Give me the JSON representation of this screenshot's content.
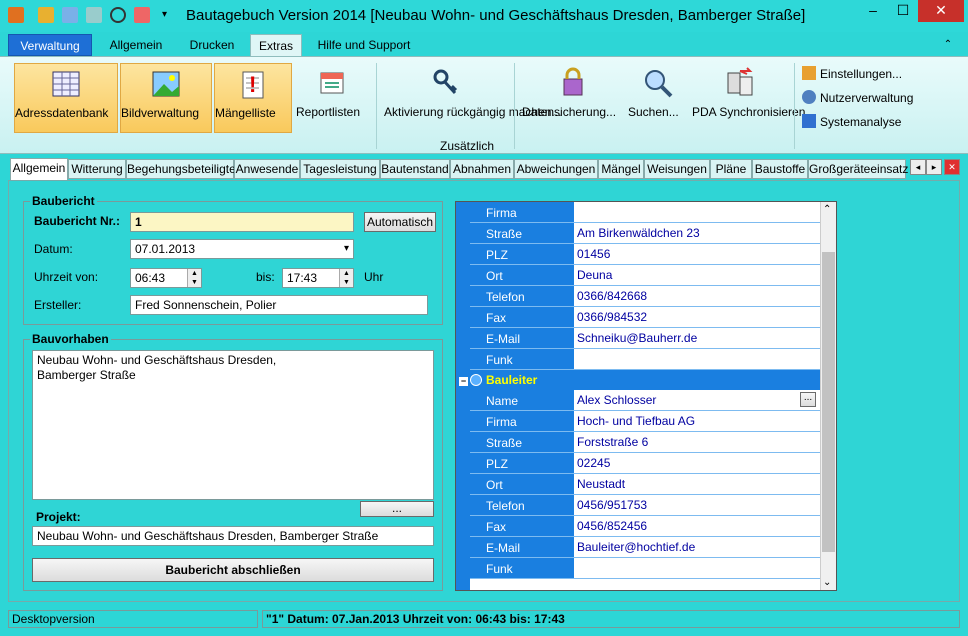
{
  "window": {
    "title": "Bautagebuch Version 2014 [Neubau Wohn- und Geschäftshaus Dresden, Bamberger Straße]",
    "controls": [
      "–",
      "☐",
      "✕"
    ]
  },
  "ribbon_tabs": [
    "Verwaltung",
    "Allgemein",
    "Drucken",
    "Extras",
    "Hilfe und Support"
  ],
  "ribbon": {
    "buttons": [
      {
        "label": "Adressdatenbank",
        "icon": "address-book-icon"
      },
      {
        "label": "Bildverwaltung",
        "icon": "image-icon"
      },
      {
        "label": "Mängelliste",
        "icon": "defect-list-icon"
      },
      {
        "label": "Reportlisten",
        "icon": "report-icon"
      },
      {
        "label": "Aktivierung rückgängig machen...",
        "icon": "keys-icon"
      },
      {
        "label": "Datensicherung...",
        "icon": "backup-icon"
      },
      {
        "label": "Suchen...",
        "icon": "search-icon"
      },
      {
        "label": "PDA Synchronisieren",
        "icon": "pda-sync-icon"
      }
    ],
    "small_buttons": [
      "Einstellungen...",
      "Nutzerverwaltung",
      "Systemanalyse"
    ],
    "group_label": "Zusätzlich"
  },
  "page_tabs": [
    "Allgemein",
    "Witterung",
    "Begehungsbeteiligte",
    "Anwesende",
    "Tagesleistung",
    "Bautenstand",
    "Abnahmen",
    "Abweichungen",
    "Mängel",
    "Weisungen",
    "Pläne",
    "Baustoffe",
    "Großgeräteeinsatz"
  ],
  "baubericht": {
    "title": "Baubericht",
    "nr_label": "Baubericht Nr.:",
    "nr_value": "1",
    "auto_button": "Automatisch",
    "datum_label": "Datum:",
    "datum_value": "07.01.2013",
    "uhrzeit_label": "Uhrzeit von:",
    "von_value": "06:43",
    "bis_label": "bis:",
    "bis_value": "17:43",
    "uhr_label": "Uhr",
    "ersteller_label": "Ersteller:",
    "ersteller_value": "Fred Sonnenschein, Polier"
  },
  "bauvorhaben": {
    "title": "Bauvorhaben",
    "text_line1": "Neubau Wohn- und Geschäftshaus Dresden,",
    "text_line2": "Bamberger Straße",
    "dots_button": "...",
    "projekt_label": "Projekt:",
    "projekt_value": "Neubau Wohn- und Geschäftshaus Dresden, Bamberger Straße",
    "close_button": "Baubericht abschließen"
  },
  "grid": {
    "top_rows": [
      {
        "key": "Firma",
        "value": ""
      },
      {
        "key": "Straße",
        "value": "Am Birkenwäldchen 23"
      },
      {
        "key": "PLZ",
        "value": "01456"
      },
      {
        "key": "Ort",
        "value": "Deuna"
      },
      {
        "key": "Telefon",
        "value": "0366/842668"
      },
      {
        "key": "Fax",
        "value": "0366/984532"
      },
      {
        "key": "E-Mail",
        "value": "Schneiku@Bauherr.de"
      },
      {
        "key": "Funk",
        "value": ""
      }
    ],
    "category": "Bauleiter",
    "bl_rows": [
      {
        "key": "Name",
        "value": "Alex Schlosser"
      },
      {
        "key": "Firma",
        "value": "Hoch- und Tiefbau AG"
      },
      {
        "key": "Straße",
        "value": "Forststraße 6"
      },
      {
        "key": "PLZ",
        "value": "02245"
      },
      {
        "key": "Ort",
        "value": "Neustadt"
      },
      {
        "key": "Telefon",
        "value": "0456/951753"
      },
      {
        "key": "Fax",
        "value": "0456/852456"
      },
      {
        "key": "E-Mail",
        "value": "Bauleiter@hochtief.de"
      },
      {
        "key": "Funk",
        "value": ""
      }
    ],
    "ellipsis": "..."
  },
  "statusbar": {
    "left": "Desktopversion",
    "right": "\"1\"  Datum: 07.Jan.2013  Uhrzeit von: 06:43  bis: 17:43"
  },
  "colors": {
    "bg": "#2dd6d6",
    "grid_key": "#1a7fe0",
    "grid_value_text": "#0000a0",
    "highlight": "#f9c95c"
  }
}
